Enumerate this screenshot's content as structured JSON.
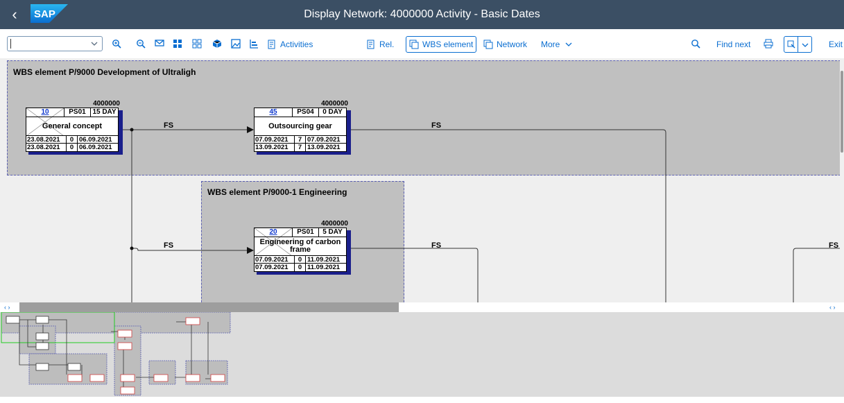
{
  "window": {
    "title": "Display Network: 4000000 Activity - Basic Dates",
    "logo_text": "SAP",
    "back_glyph": "‹"
  },
  "toolbar": {
    "command_field_value": "",
    "activities_label": "Activities",
    "rel_label": "Rel.",
    "wbs_element_label": "WBS element",
    "network_label": "Network",
    "more_label": "More",
    "find_next_label": "Find next",
    "exit_label": "Exit",
    "icons": [
      "zoom-in-icon",
      "zoom-out-icon",
      "mail-icon",
      "grid-icon",
      "overview-icon",
      "cube-icon",
      "image-icon",
      "chart-icon",
      "search-icon",
      "print-icon",
      "settings-icon"
    ]
  },
  "wbs_elements": [
    {
      "title": "WBS element P/9000 Development of Ultraligh"
    },
    {
      "title": "WBS element P/9000-1 Engineering"
    }
  ],
  "activities": [
    {
      "network": "4000000",
      "number": "10",
      "control_key": "PS01",
      "duration": "15 DAY",
      "name": "General concept",
      "row1": {
        "date1": "23.08.2021",
        "float": "0",
        "date2": "06.09.2021"
      },
      "row2": {
        "date1": "23.08.2021",
        "float": "0",
        "date2": "06.09.2021"
      }
    },
    {
      "network": "4000000",
      "number": "45",
      "control_key": "PS04",
      "duration": "0 DAY",
      "name": "Outsourcing gear",
      "row1": {
        "date1": "07.09.2021",
        "float": "7",
        "date2": "07.09.2021"
      },
      "row2": {
        "date1": "13.09.2021",
        "float": "7",
        "date2": "13.09.2021"
      }
    },
    {
      "network": "4000000",
      "number": "20",
      "control_key": "PS01",
      "duration": "5 DAY",
      "name": "Engineering of carbon frame",
      "row1": {
        "date1": "07.09.2021",
        "float": "0",
        "date2": "11.09.2021"
      },
      "row2": {
        "date1": "07.09.2021",
        "float": "0",
        "date2": "11.09.2021"
      }
    }
  ],
  "relationships": [
    "FS",
    "FS",
    "FS",
    "FS",
    "FS"
  ],
  "scroll_arrows": "‹ ›"
}
